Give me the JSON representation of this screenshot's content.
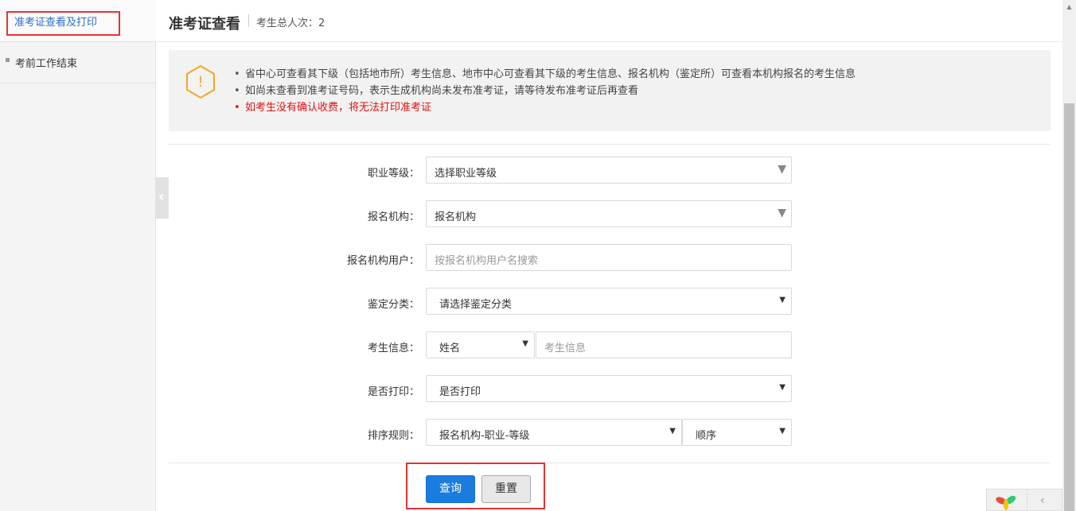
{
  "sidebar": {
    "items": [
      {
        "label": "准考证查看及打印",
        "active": true
      },
      {
        "label": "考前工作结束",
        "active": false
      }
    ]
  },
  "header": {
    "title": "准考证查看",
    "count_label": "考生总人次：",
    "count_value": "2"
  },
  "notice": {
    "lines": [
      "省中心可查看其下级（包括地市所）考生信息、地市中心可查看其下级的考生信息、报名机构（鉴定所）可查看本机构报名的考生信息",
      "如尚未查看到准考证号码，表示生成机构尚未发布准考证，请等待发布准考证后再查看",
      "如考生没有确认收费，将无法打印准考证"
    ]
  },
  "form": {
    "level": {
      "label": "职业等级：",
      "value": "选择职业等级"
    },
    "org": {
      "label": "报名机构：",
      "value": "报名机构"
    },
    "org_user": {
      "label": "报名机构用户：",
      "placeholder": "按报名机构用户名搜索"
    },
    "category": {
      "label": "鉴定分类：",
      "value": "请选择鉴定分类"
    },
    "candidate": {
      "label": "考生信息：",
      "type_value": "姓名",
      "placeholder": "考生信息"
    },
    "printed": {
      "label": "是否打印：",
      "value": "是否打印"
    },
    "sort": {
      "label": "排序规则：",
      "field_value": "报名机构-职业-等级",
      "order_value": "顺序"
    }
  },
  "buttons": {
    "query": "查询",
    "reset": "重置"
  },
  "colors": {
    "primary": "#1a7be0",
    "link": "#2a6fc9",
    "warning": "#f5a623",
    "danger": "#e01010",
    "annotation": "#e53333"
  }
}
